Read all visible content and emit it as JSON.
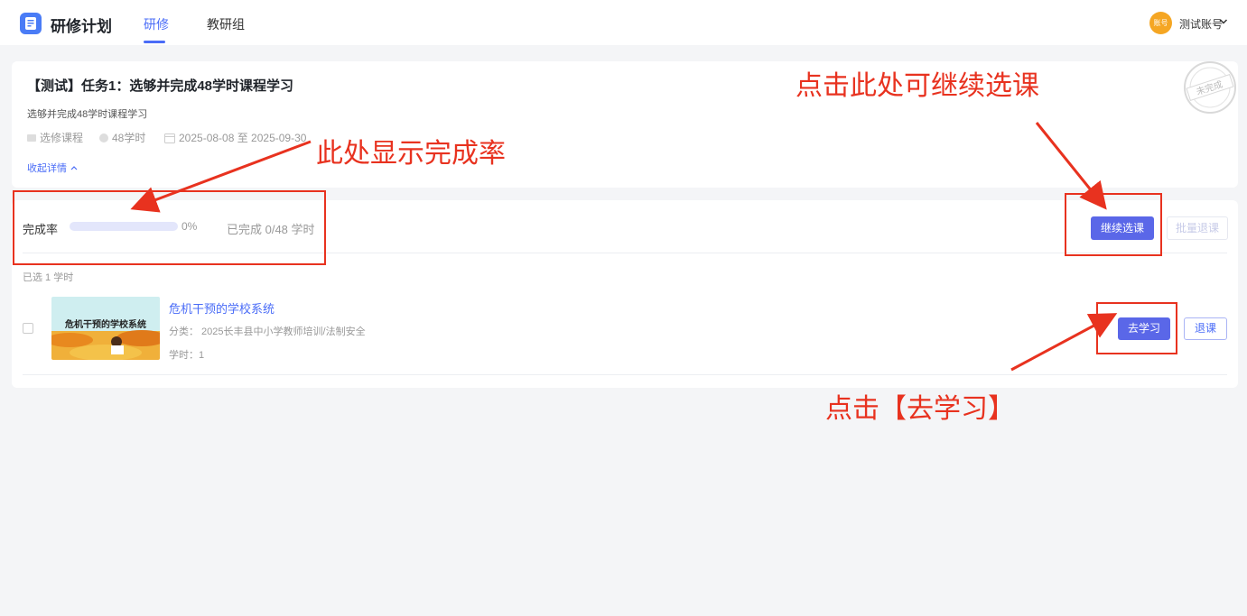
{
  "header": {
    "app_title": "研修计划",
    "tabs": [
      {
        "label": "研修",
        "active": true
      },
      {
        "label": "教研组",
        "active": false
      }
    ],
    "avatar_text": "账号",
    "user_name": "测试账号"
  },
  "task": {
    "title": "【测试】任务1：选够并完成48学时课程学习",
    "description": "选够并完成48学时课程学习",
    "meta": {
      "type": "选修课程",
      "hours": "48学时",
      "date_range": "2025-08-08 至 2025-09-30"
    },
    "collapse_label": "收起详情",
    "stamp_text": "未完成"
  },
  "progress": {
    "label": "完成率",
    "percent": 0,
    "percent_text": "0%",
    "completed_text": "已完成 0/48 学时",
    "continue_button": "继续选课",
    "batch_drop_button": "批量退课"
  },
  "selected_info": "已选 1 学时",
  "courses": [
    {
      "thumbnail_text": "危机干预的学校系统",
      "title": "危机干预的学校系统",
      "category": "分类：  2025长丰县中小学教师培训/法制安全",
      "hours": "学时：1",
      "study_button": "去学习",
      "drop_button": "退课"
    }
  ],
  "annotations": {
    "continue_hint": "点击此处可继续选课",
    "rate_hint": "此处显示完成率",
    "study_hint": "点击【去学习】",
    "color": "#e8321f"
  }
}
